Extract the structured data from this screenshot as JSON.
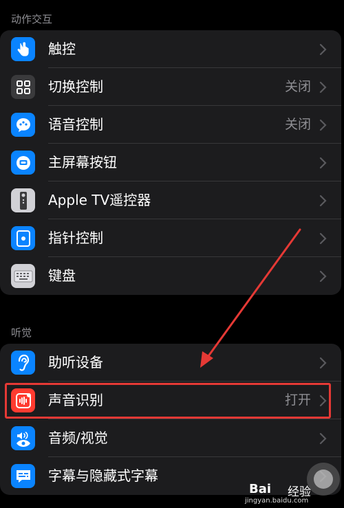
{
  "sections": [
    {
      "header": "动作交互",
      "items": [
        {
          "label": "触控",
          "value": "",
          "icon": "hand-touch-icon",
          "color": "#0a84ff"
        },
        {
          "label": "切换控制",
          "value": "关闭",
          "icon": "grid-icon",
          "color": "#3a3a3c"
        },
        {
          "label": "语音控制",
          "value": "关闭",
          "icon": "speech-bubble-icon",
          "color": "#0a84ff"
        },
        {
          "label": "主屏幕按钮",
          "value": "",
          "icon": "home-button-icon",
          "color": "#0a84ff"
        },
        {
          "label": "Apple TV遥控器",
          "value": "",
          "icon": "remote-icon",
          "color": "#8e8e93"
        },
        {
          "label": "指针控制",
          "value": "",
          "icon": "pointer-icon",
          "color": "#0a84ff"
        },
        {
          "label": "键盘",
          "value": "",
          "icon": "keyboard-icon",
          "color": "#8e8e93"
        }
      ]
    },
    {
      "header": "听觉",
      "items": [
        {
          "label": "助听设备",
          "value": "",
          "icon": "ear-icon",
          "color": "#0a84ff"
        },
        {
          "label": "声音识别",
          "value": "打开",
          "icon": "sound-recognition-icon",
          "color": "#ff3b30"
        },
        {
          "label": "音频/视觉",
          "value": "",
          "icon": "audio-visual-icon",
          "color": "#0a84ff"
        },
        {
          "label": "字幕与隐藏式字幕",
          "value": "",
          "icon": "captions-icon",
          "color": "#0a84ff"
        }
      ]
    }
  ],
  "highlight_color": "#e53935",
  "watermark": {
    "brand": "Bai",
    "sub_brand": "经验",
    "url": "jingyan.baidu.com"
  }
}
